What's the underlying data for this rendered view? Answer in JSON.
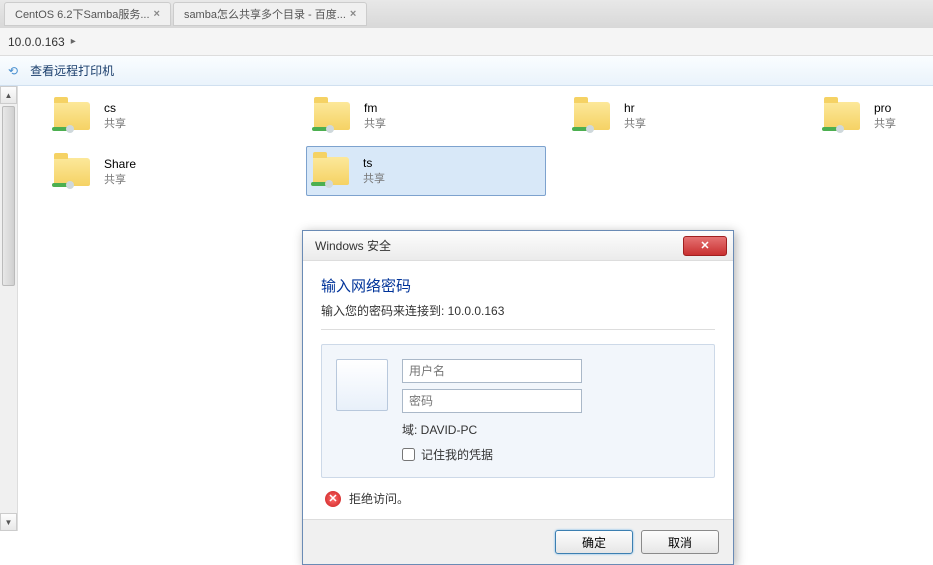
{
  "browser": {
    "tabs": [
      {
        "label": "CentOS 6.2下Samba服务..."
      },
      {
        "label": "samba怎么共享多个目录 - 百度..."
      }
    ]
  },
  "address": {
    "path": "10.0.0.163",
    "arrow": "▸"
  },
  "toolbar": {
    "home": "⟲",
    "view_printer": "查看远程打印机"
  },
  "shares": [
    {
      "name": "cs",
      "sub": "共享"
    },
    {
      "name": "fm",
      "sub": "共享"
    },
    {
      "name": "hr",
      "sub": "共享"
    },
    {
      "name": "pro",
      "sub": "共享"
    },
    {
      "name": "Share",
      "sub": "共享"
    },
    {
      "name": "ts",
      "sub": "共享",
      "selected": true
    }
  ],
  "dialog": {
    "title": "Windows 安全",
    "heading": "输入网络密码",
    "subtitle": "输入您的密码来连接到: 10.0.0.163",
    "username_placeholder": "用户名",
    "password_placeholder": "密码",
    "domain_label": "域: DAVID-PC",
    "remember_label": "记住我的凭据",
    "error": "拒绝访问。",
    "ok": "确定",
    "cancel": "取消",
    "close_glyph": "✕"
  }
}
